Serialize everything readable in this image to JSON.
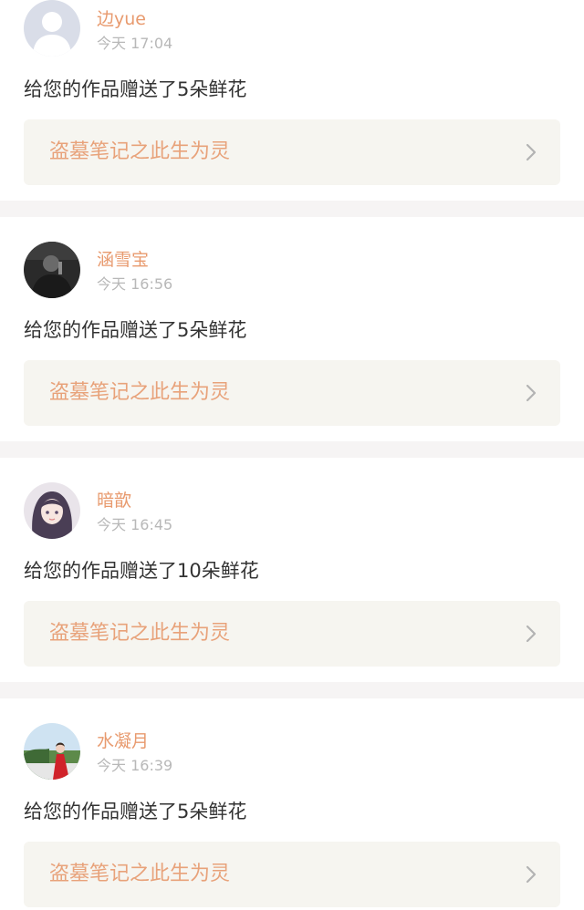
{
  "notifications": [
    {
      "avatar_icon": "default-user-avatar-icon",
      "username": "边yue",
      "time": "今天 17:04",
      "message": "给您的作品赠送了5朵鲜花",
      "work_title": "盗墓笔记之此生为灵"
    },
    {
      "avatar_icon": "photo-avatar-icon",
      "username": "涵雪宝",
      "time": "今天 16:56",
      "message": "给您的作品赠送了5朵鲜花",
      "work_title": "盗墓笔记之此生为灵"
    },
    {
      "avatar_icon": "anime-girl-avatar-icon",
      "username": "暗歆",
      "time": "今天 16:45",
      "message": "给您的作品赠送了10朵鲜花",
      "work_title": "盗墓笔记之此生为灵"
    },
    {
      "avatar_icon": "landscape-avatar-icon",
      "username": "水凝月",
      "time": "今天 16:39",
      "message": "给您的作品赠送了5朵鲜花",
      "work_title": "盗墓笔记之此生为灵"
    }
  ],
  "colors": {
    "username": "#e89a6e",
    "work_title": "#e8a27a",
    "message": "#333333",
    "time": "#b8b8b8",
    "separator": "#f6f4f4",
    "link_background": "#f6f5f0"
  }
}
